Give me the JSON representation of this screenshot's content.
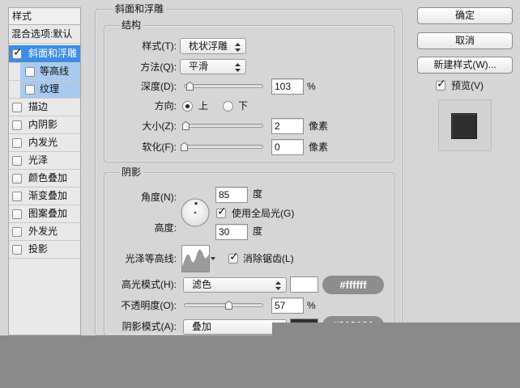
{
  "colors": {
    "selected_row": "#3b8de6",
    "sub_row": "#a7caf0",
    "overlay": "#8a8a8a"
  },
  "left_panel": {
    "header": "样式",
    "blend_options": "混合选项:默认",
    "items": [
      {
        "label": "斜面和浮雕",
        "checked": true
      },
      {
        "label": "等高线",
        "checked": false
      },
      {
        "label": "纹理",
        "checked": false
      },
      {
        "label": "描边",
        "checked": false
      },
      {
        "label": "内阴影",
        "checked": false
      },
      {
        "label": "内发光",
        "checked": false
      },
      {
        "label": "光泽",
        "checked": false
      },
      {
        "label": "颜色叠加",
        "checked": false
      },
      {
        "label": "渐变叠加",
        "checked": false
      },
      {
        "label": "图案叠加",
        "checked": false
      },
      {
        "label": "外发光",
        "checked": false
      },
      {
        "label": "投影",
        "checked": false
      }
    ]
  },
  "bevel": {
    "title": "斜面和浮雕"
  },
  "structure": {
    "title": "结构",
    "style": {
      "label": "样式(T):",
      "value": "枕状浮雕"
    },
    "technique": {
      "label": "方法(Q):",
      "value": "平滑"
    },
    "depth": {
      "label": "深度(D):",
      "value": "103",
      "unit": "%",
      "slider": 0.08
    },
    "direction": {
      "label": "方向:",
      "up": "上",
      "down": "下",
      "up_selected": true,
      "down_selected": false
    },
    "size": {
      "label": "大小(Z):",
      "value": "2",
      "unit": "像素",
      "slider": 0.03
    },
    "soften": {
      "label": "软化(F):",
      "value": "0",
      "unit": "像素",
      "slider": 0.01
    }
  },
  "shading": {
    "title": "阴影",
    "angle": {
      "label": "角度(N):",
      "value": "85",
      "unit": "度"
    },
    "global_light": {
      "label": "使用全局光(G)",
      "checked": true
    },
    "altitude": {
      "label": "高度:",
      "value": "30",
      "unit": "度"
    },
    "gloss_contour": {
      "label": "光泽等高线:"
    },
    "anti_aliased": {
      "label": "消除锯齿(L)",
      "checked": true
    },
    "highlight_mode": {
      "label": "高光模式(H):",
      "value": "滤色",
      "color": "#ffffff",
      "badge": "#ffffff"
    },
    "opacity": {
      "label": "不透明度(O):",
      "value": "57",
      "unit": "%",
      "slider": 0.57
    },
    "shadow_mode": {
      "label": "阴影模式(A):",
      "value": "叠加",
      "color": "#313131",
      "badge": "#313131"
    }
  },
  "buttons": {
    "ok": "确定",
    "cancel": "取消",
    "new_style": "新建样式(W)..."
  },
  "preview": {
    "label": "预览(V)",
    "checked": true,
    "sample_color": "#2e2e2e"
  }
}
